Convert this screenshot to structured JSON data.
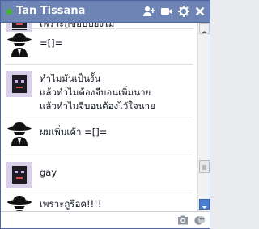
{
  "titlebar": {
    "title": "Tan Tissana",
    "status": "online",
    "icons": [
      "add-friend-icon",
      "video-call-icon",
      "gear-icon",
      "close-icon"
    ]
  },
  "colors": {
    "titlebar_bg": "#6d84b4",
    "online": "#42b72a",
    "scroll_arrow_active": "#4c7fd1"
  },
  "messages": [
    {
      "sender": "partner",
      "avatar": "pixel-face-avatar",
      "lines": [
        "เพราะกูชอบปิยังไม่"
      ]
    },
    {
      "sender": "me",
      "avatar": "spy-hat-avatar",
      "lines": [
        "=[]="
      ]
    },
    {
      "sender": "partner",
      "avatar": "pixel-face-avatar",
      "lines": [
        "ทำไมมันเป็นงั้น",
        "แล้วทำไมต้องจีบอนเพิ่มนาย",
        "แล้วทำไมจีบอนต้องไว้ใจนาย"
      ]
    },
    {
      "sender": "me",
      "avatar": "spy-hat-avatar",
      "lines": [
        "ผมเพิ่มเค้า =[]="
      ]
    },
    {
      "sender": "partner",
      "avatar": "pixel-face-avatar",
      "lines": [
        "gay"
      ]
    },
    {
      "sender": "me",
      "avatar": "spy-hat-avatar",
      "lines": [
        "เพราะกูรึอค!!!!"
      ]
    }
  ],
  "composer": {
    "placeholder": "",
    "icons": [
      "camera-icon",
      "sticker-icon"
    ]
  }
}
